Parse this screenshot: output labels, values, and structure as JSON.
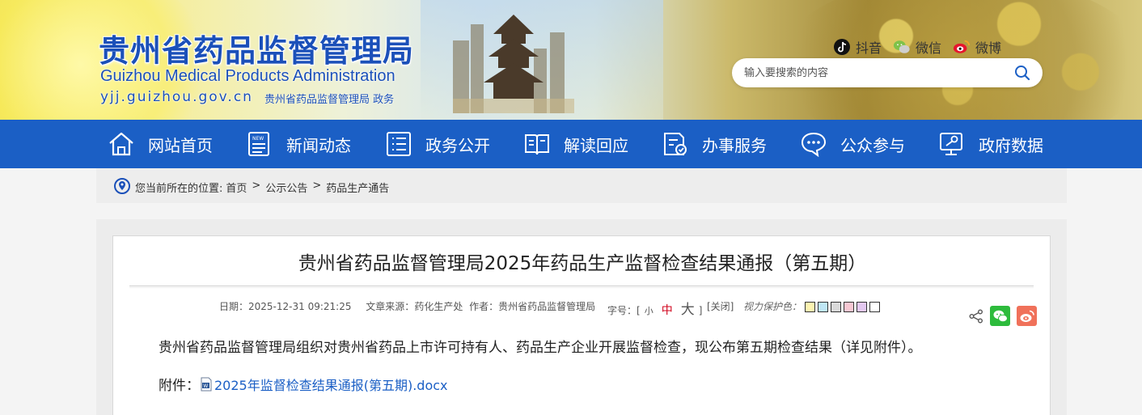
{
  "header": {
    "site_name_cn": "贵州省药品监督管理局",
    "site_name_en": "Guizhou Medical Products Administration",
    "site_url": "yjj.guizhou.gov.cn",
    "slogan": "贵州省药品监督管理局 政务",
    "social": [
      {
        "label": "抖音",
        "icon": "douyin-icon"
      },
      {
        "label": "微信",
        "icon": "wechat-icon"
      },
      {
        "label": "微博",
        "icon": "weibo-icon"
      }
    ],
    "search": {
      "placeholder": "输入要搜索的内容",
      "value": ""
    }
  },
  "nav": {
    "items": [
      {
        "label": "网站首页",
        "icon": "home-icon"
      },
      {
        "label": "新闻动态",
        "icon": "news-icon"
      },
      {
        "label": "政务公开",
        "icon": "list-icon"
      },
      {
        "label": "解读回应",
        "icon": "book-icon"
      },
      {
        "label": "办事服务",
        "icon": "service-icon"
      },
      {
        "label": "公众参与",
        "icon": "chat-icon"
      },
      {
        "label": "政府数据",
        "icon": "data-icon"
      }
    ]
  },
  "breadcrumb": {
    "prefix": "您当前所在的位置:",
    "items": [
      "首页",
      "公示公告",
      "药品生产通告"
    ],
    "separator": ">"
  },
  "article": {
    "title": "贵州省药品监督管理局2025年药品生产监督检查结果通报（第五期）",
    "meta": {
      "date_label": "日期：",
      "date": "2025-12-31 09:21:25",
      "source_label": "文章来源：",
      "source": "药化生产处",
      "author_label": "作者：",
      "author": "贵州省药品监督管理局"
    },
    "font_size": {
      "label": "字号：[",
      "small": "小",
      "medium": "中",
      "large": "大",
      "end": "]"
    },
    "close_label": "[关闭]",
    "eye_protection_label": "视力保护色：",
    "swatch_colors": [
      "#fdf3b0",
      "#bfe6f5",
      "#d9d9d9",
      "#f7c8d3",
      "#e3c8f0",
      "#ffffff"
    ],
    "body": "贵州省药品监督管理局组织对贵州省药品上市许可持有人、药品生产企业开展监督检查，现公布第五期检查结果（详见附件）。",
    "attachment_label": "附件：",
    "attachment_name": "2025年监督检查结果通报(第五期).docx",
    "share": [
      {
        "icon": "share-icon"
      },
      {
        "icon": "wechat-share-icon",
        "color": "#2dbb3c"
      },
      {
        "icon": "weibo-share-icon",
        "color": "#f0715a"
      }
    ]
  },
  "colors": {
    "brand_blue": "#1b5fc5",
    "logo_blue": "#1b50b9",
    "active_red": "#d0021b"
  }
}
